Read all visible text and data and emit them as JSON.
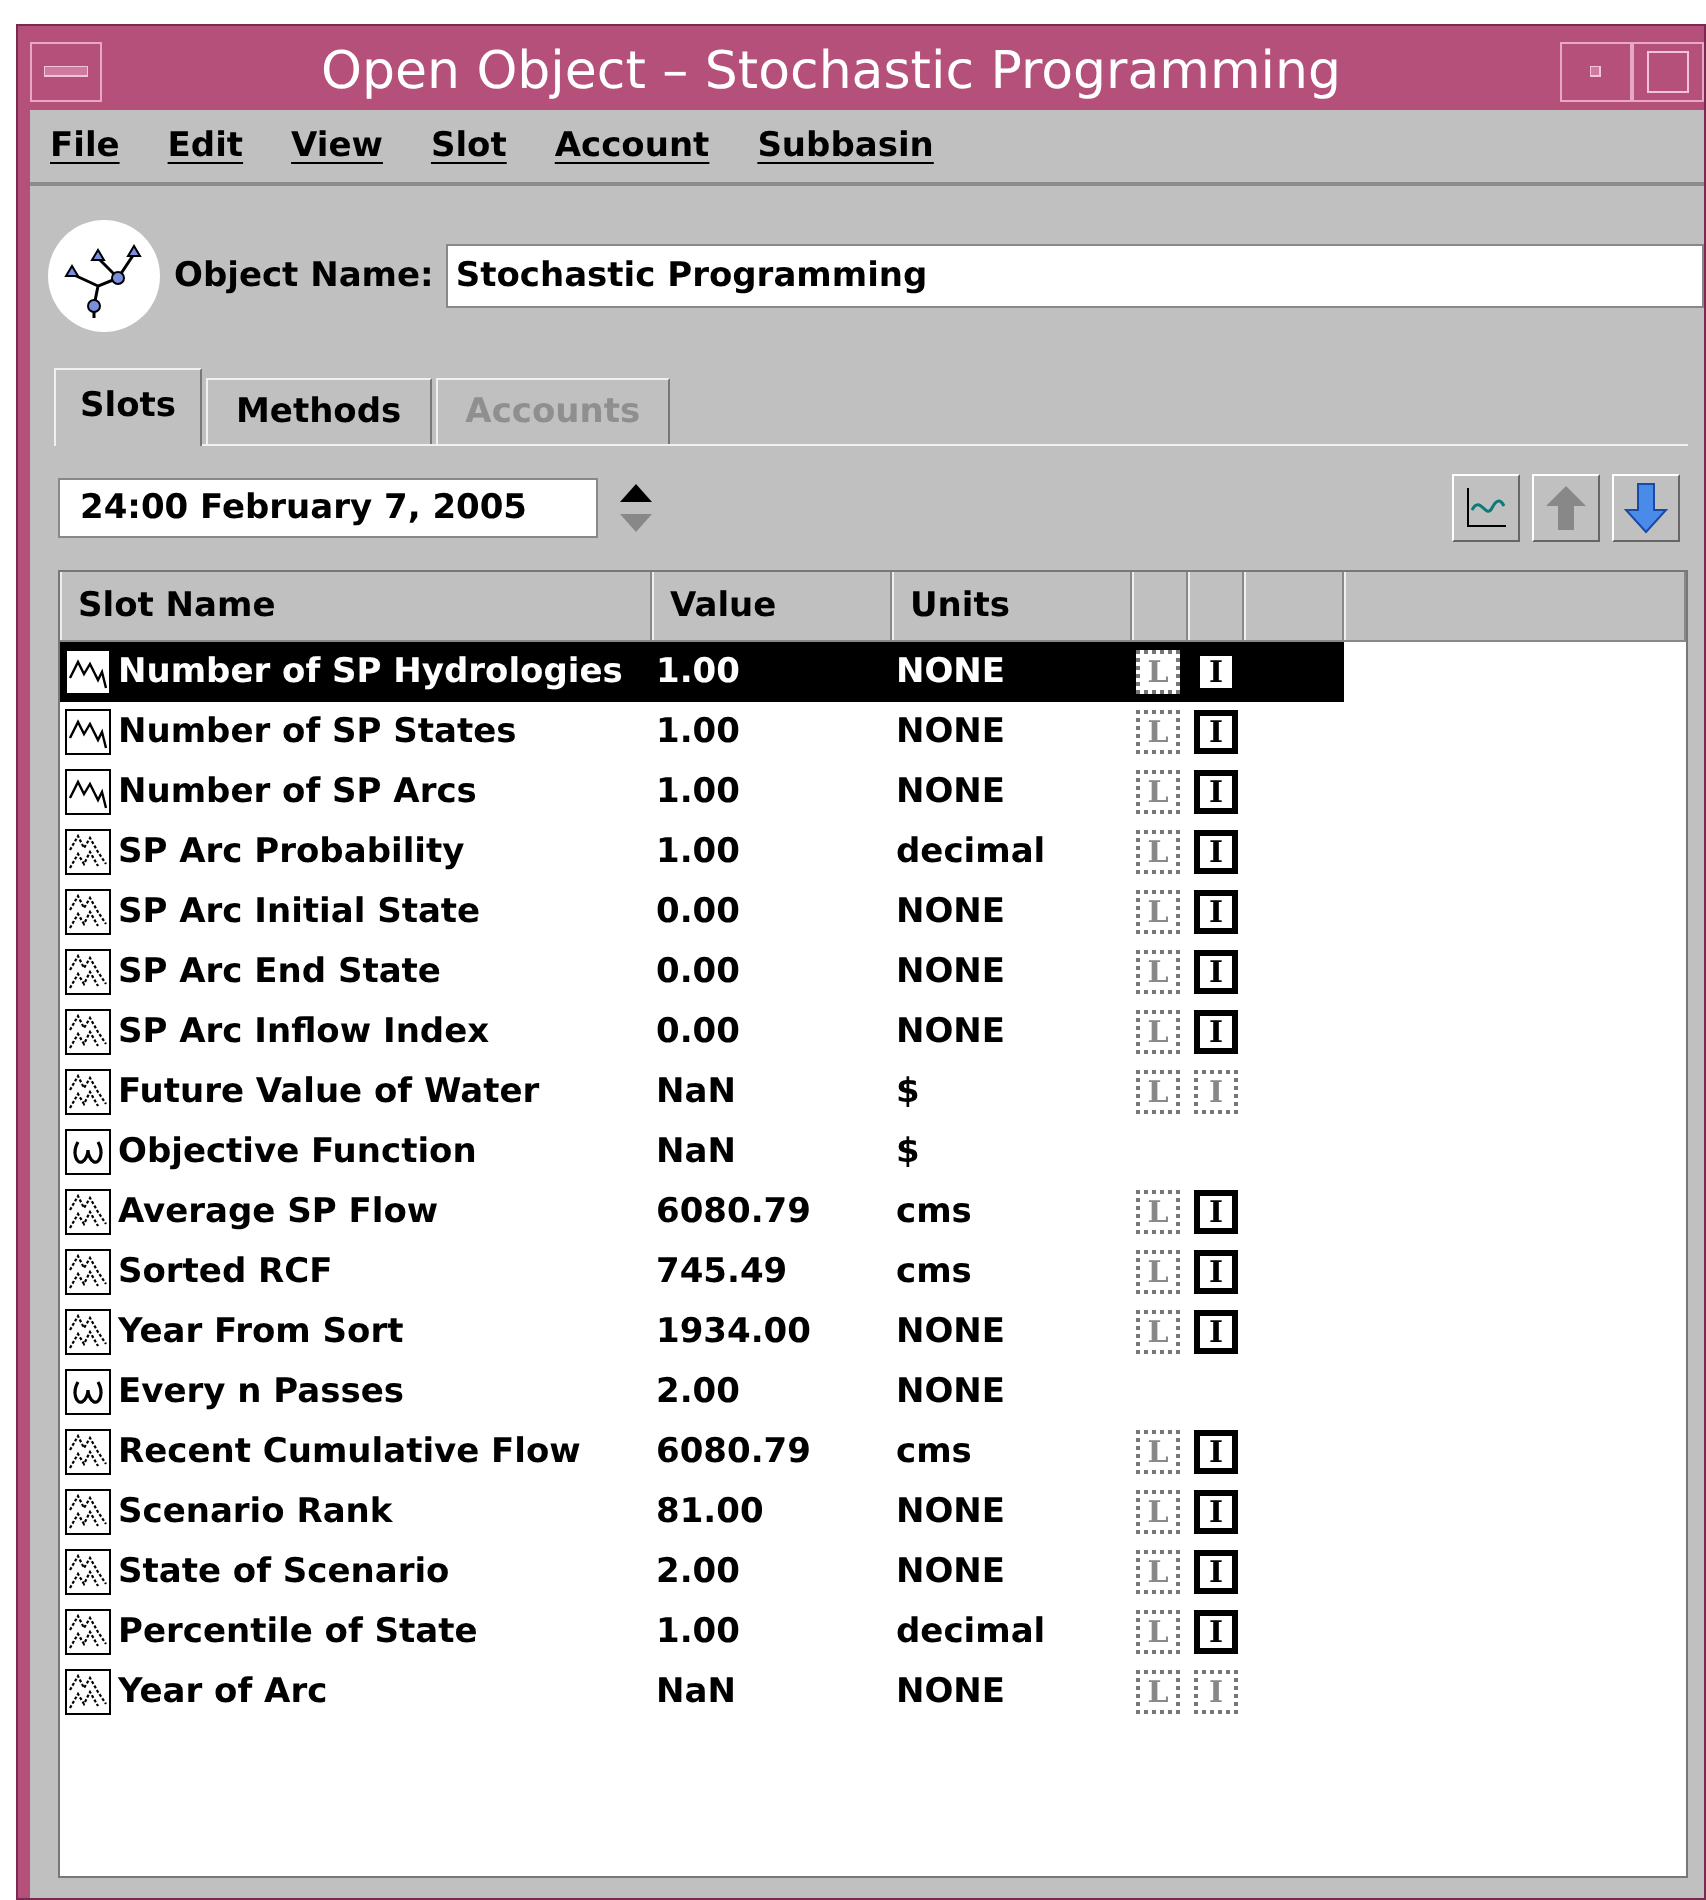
{
  "window": {
    "title": "Open Object – Stochastic Programming"
  },
  "menu": [
    "File",
    "Edit",
    "View",
    "Slot",
    "Account",
    "Subbasin"
  ],
  "object_name": {
    "label": "Object Name:",
    "value": "Stochastic Programming"
  },
  "tabs": [
    {
      "label": "Slots",
      "selected": true,
      "disabled": false
    },
    {
      "label": "Methods",
      "selected": false,
      "disabled": false
    },
    {
      "label": "Accounts",
      "selected": false,
      "disabled": true
    }
  ],
  "timestep": {
    "value": "24:00 February 7, 2005"
  },
  "table": {
    "columns": [
      "Slot Name",
      "Value",
      "Units"
    ],
    "rows": [
      {
        "kind": "scalar",
        "name": "Number of SP Hydrologies",
        "value": "1.00",
        "units": "NONE",
        "selected": true,
        "flags": [
          {
            "label": "L",
            "active": false
          },
          {
            "label": "I",
            "active": true
          }
        ]
      },
      {
        "kind": "scalar",
        "name": "Number of SP States",
        "value": "1.00",
        "units": "NONE",
        "selected": false,
        "flags": [
          {
            "label": "L",
            "active": false
          },
          {
            "label": "I",
            "active": true
          }
        ]
      },
      {
        "kind": "scalar",
        "name": "Number of SP Arcs",
        "value": "1.00",
        "units": "NONE",
        "selected": false,
        "flags": [
          {
            "label": "L",
            "active": false
          },
          {
            "label": "I",
            "active": true
          }
        ]
      },
      {
        "kind": "series",
        "name": "SP Arc Probability",
        "value": "1.00",
        "units": "decimal",
        "selected": false,
        "flags": [
          {
            "label": "L",
            "active": false
          },
          {
            "label": "I",
            "active": true
          }
        ]
      },
      {
        "kind": "series",
        "name": "SP Arc Initial State",
        "value": "0.00",
        "units": "NONE",
        "selected": false,
        "flags": [
          {
            "label": "L",
            "active": false
          },
          {
            "label": "I",
            "active": true
          }
        ]
      },
      {
        "kind": "series",
        "name": "SP Arc End State",
        "value": "0.00",
        "units": "NONE",
        "selected": false,
        "flags": [
          {
            "label": "L",
            "active": false
          },
          {
            "label": "I",
            "active": true
          }
        ]
      },
      {
        "kind": "series",
        "name": "SP Arc Inflow Index",
        "value": "0.00",
        "units": "NONE",
        "selected": false,
        "flags": [
          {
            "label": "L",
            "active": false
          },
          {
            "label": "I",
            "active": true
          }
        ]
      },
      {
        "kind": "series",
        "name": "Future Value of Water",
        "value": "NaN",
        "units": "$",
        "selected": false,
        "flags": [
          {
            "label": "L",
            "active": false
          },
          {
            "label": "I",
            "active": false
          }
        ]
      },
      {
        "kind": "expression",
        "name": "Objective Function",
        "value": "NaN",
        "units": "$",
        "selected": false
      },
      {
        "kind": "series",
        "name": "Average SP Flow",
        "value": "6080.79",
        "units": "cms",
        "selected": false,
        "flags": [
          {
            "label": "L",
            "active": false
          },
          {
            "label": "I",
            "active": true
          }
        ]
      },
      {
        "kind": "series",
        "name": "Sorted RCF",
        "value": "745.49",
        "units": "cms",
        "selected": false,
        "flags": [
          {
            "label": "L",
            "active": false
          },
          {
            "label": "I",
            "active": true
          }
        ]
      },
      {
        "kind": "series",
        "name": "Year From Sort",
        "value": "1934.00",
        "units": "NONE",
        "selected": false,
        "flags": [
          {
            "label": "L",
            "active": false
          },
          {
            "label": "I",
            "active": true
          }
        ]
      },
      {
        "kind": "expression",
        "name": "Every n Passes",
        "value": "2.00",
        "units": "NONE",
        "selected": false
      },
      {
        "kind": "series",
        "name": "Recent Cumulative Flow",
        "value": "6080.79",
        "units": "cms",
        "selected": false,
        "flags": [
          {
            "label": "L",
            "active": false
          },
          {
            "label": "I",
            "active": true
          }
        ]
      },
      {
        "kind": "series",
        "name": "Scenario Rank",
        "value": "81.00",
        "units": "NONE",
        "selected": false,
        "flags": [
          {
            "label": "L",
            "active": false
          },
          {
            "label": "I",
            "active": true
          }
        ]
      },
      {
        "kind": "series",
        "name": "State of Scenario",
        "value": "2.00",
        "units": "NONE",
        "selected": false,
        "flags": [
          {
            "label": "L",
            "active": false
          },
          {
            "label": "I",
            "active": true
          }
        ]
      },
      {
        "kind": "series",
        "name": "Percentile of State",
        "value": "1.00",
        "units": "decimal",
        "selected": false,
        "flags": [
          {
            "label": "L",
            "active": false
          },
          {
            "label": "I",
            "active": true
          }
        ]
      },
      {
        "kind": "series",
        "name": "Year of Arc",
        "value": "NaN",
        "units": "NONE",
        "selected": false,
        "flags": [
          {
            "label": "L",
            "active": false
          },
          {
            "label": "I",
            "active": false
          }
        ]
      }
    ]
  }
}
